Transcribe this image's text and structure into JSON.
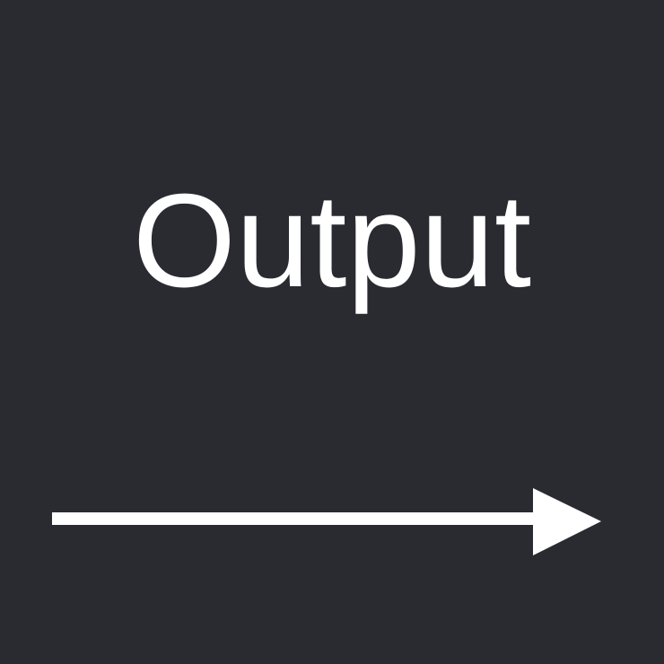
{
  "label": {
    "text": "Output"
  },
  "icon": {
    "name": "arrow-right-icon"
  },
  "colors": {
    "background": "#2a2b31",
    "foreground": "#ffffff"
  }
}
